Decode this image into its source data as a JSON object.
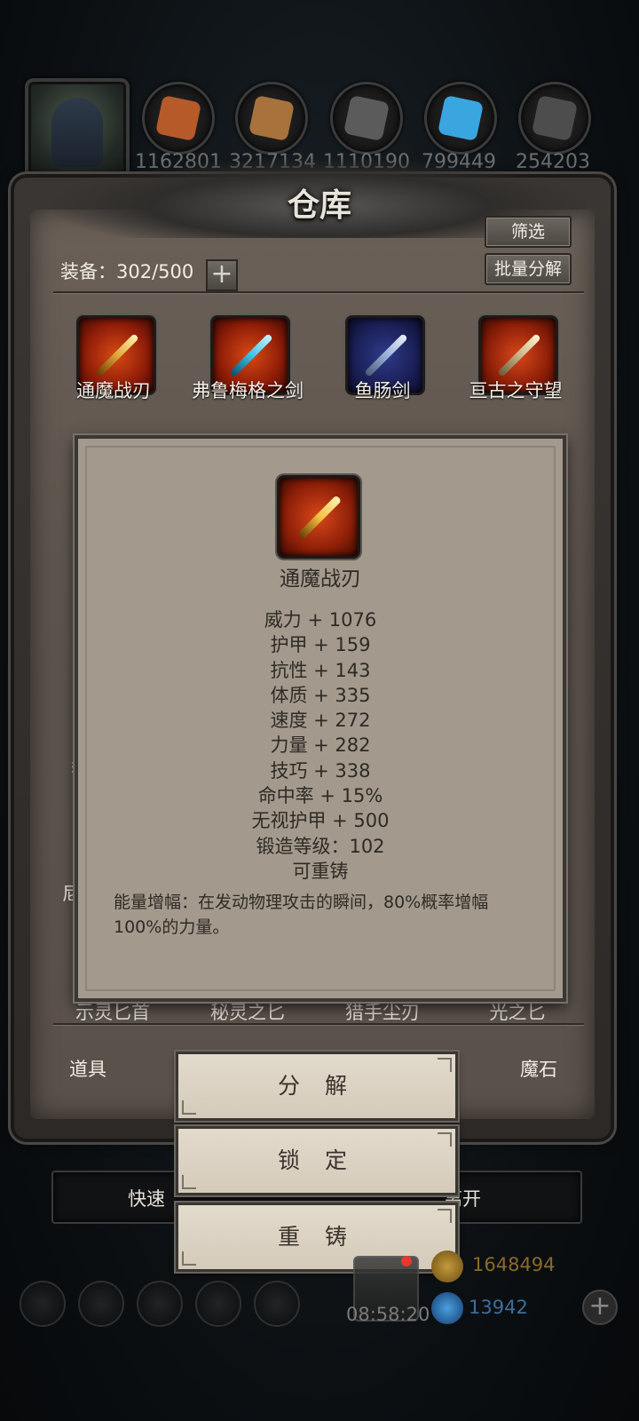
{
  "resources": [
    {
      "icon": "character-avatar",
      "value": ""
    },
    {
      "icon": "wood-icon",
      "value": "1162801",
      "color": "#b65a2a"
    },
    {
      "icon": "plank-icon",
      "value": "3217134",
      "color": "#a8723c"
    },
    {
      "icon": "iron-icon",
      "value": "1110190",
      "color": "#5b5b5b"
    },
    {
      "icon": "crystal-icon",
      "value": "799449",
      "color": "#3aa6e0"
    },
    {
      "icon": "ingot-icon",
      "value": "254203",
      "color": "#4d4d4d"
    }
  ],
  "panel": {
    "title": "仓库",
    "filter_label": "筛选",
    "bulk_label": "批量分解",
    "equip_count": "装备：302/500",
    "plus_label": "+"
  },
  "items": [
    {
      "name": "通魔战刃",
      "color": "#e0a83a"
    },
    {
      "name": "弗鲁梅格之剑",
      "color": "#38c5ea"
    },
    {
      "name": "鱼肠剑",
      "color": "#9ab0d8"
    },
    {
      "name": "亘古之守望",
      "color": "#c9b58a"
    }
  ],
  "partial_labels": [
    "示灵匕首",
    "秘灵之匕",
    "猎手尘刃",
    "光之匕"
  ],
  "side_fragments": {
    "left_a": "弄",
    "left_b": "尼"
  },
  "tooltip": {
    "name": "通魔战刃",
    "stats": [
      "威力 + 1076",
      "护甲 + 159",
      "抗性 + 143",
      "体质 + 335",
      "速度 + 272",
      "力量 + 282",
      "技巧 + 338",
      "命中率 + 15%",
      "无视护甲 + 500",
      "锻造等级：102",
      "可重铸"
    ],
    "description": "能量增幅：在发动物理攻击的瞬间，80%概率增幅100%的力量。"
  },
  "tabs": {
    "left": "道具",
    "right": "魔石"
  },
  "actions": {
    "decompose": "分 解",
    "lock": "锁 定",
    "reforge": "重 铸"
  },
  "bottom": {
    "quick_left": "快速",
    "quick_right": "离开",
    "timer": "08:58:20",
    "gold": "1648494",
    "gems": "13942",
    "add": "+"
  }
}
